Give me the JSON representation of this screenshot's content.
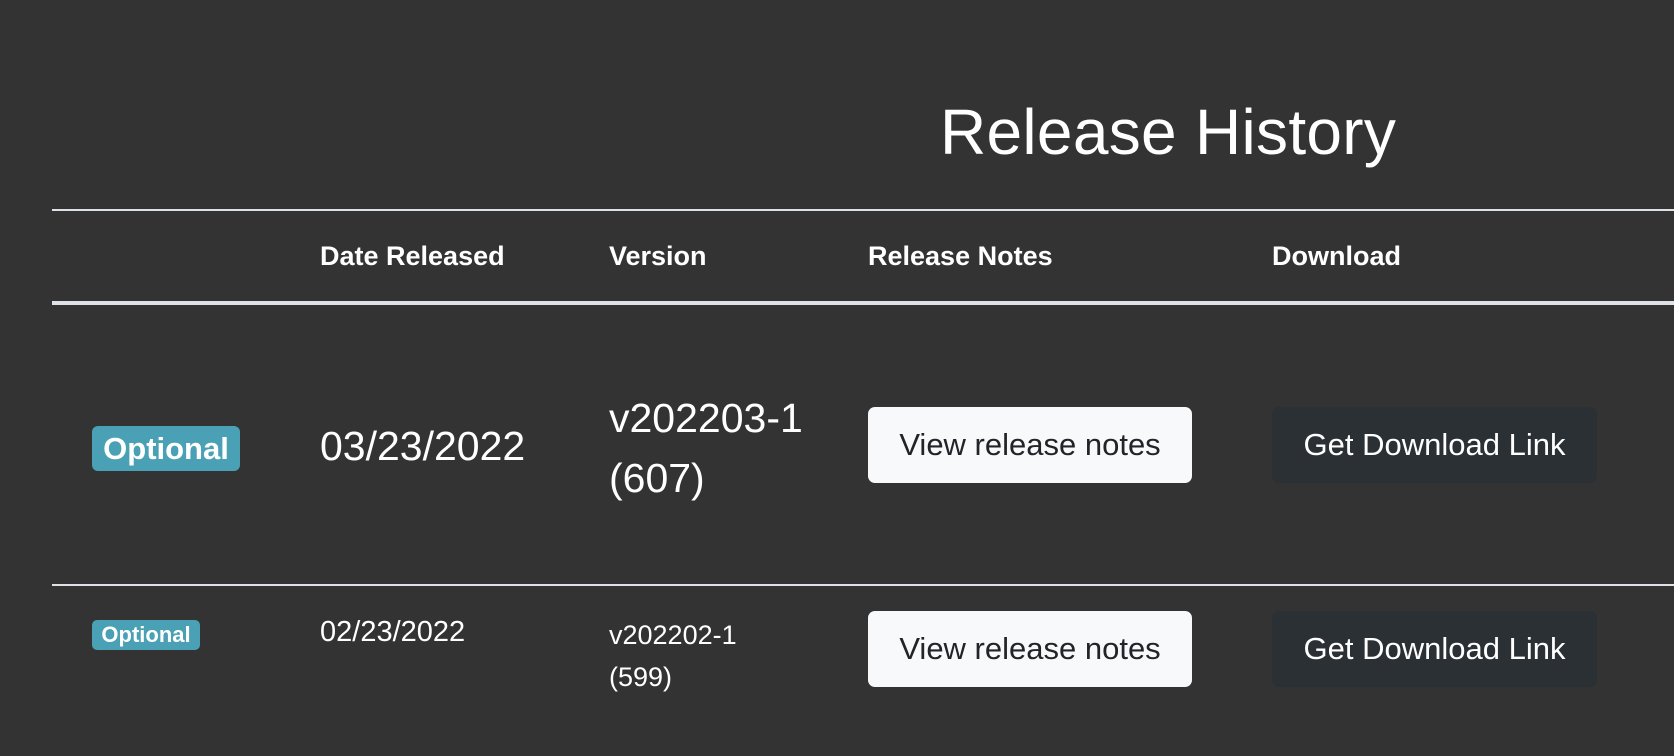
{
  "page": {
    "title": "Release History"
  },
  "table": {
    "headers": {
      "status": "",
      "date": "Date Released",
      "version": "Version",
      "notes": "Release Notes",
      "download": "Download"
    },
    "rows": [
      {
        "badge": "Optional",
        "date": "03/23/2022",
        "version": "v202203-1 (607)",
        "notes_button": "View release notes",
        "download_button": "Get Download Link"
      },
      {
        "badge": "Optional",
        "date": "02/23/2022",
        "version": "v202202-1 (599)",
        "notes_button": "View release notes",
        "download_button": "Get Download Link"
      }
    ]
  },
  "colors": {
    "background": "#333333",
    "badge": "#4aa1b5",
    "light_button": "#f8f9fa",
    "dark_button": "#2b3035",
    "rule": "#dee2e6"
  }
}
